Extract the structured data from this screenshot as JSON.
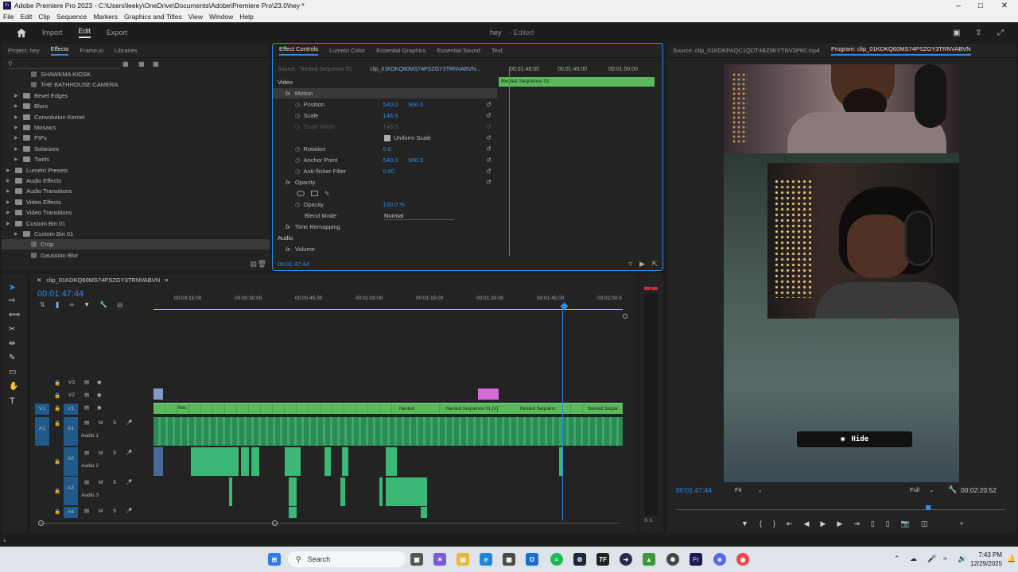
{
  "window": {
    "title": "Adobe Premiere Pro 2023 - C:\\Users\\leeky\\OneDrive\\Documents\\Adobe\\Premiere Pro\\23.0\\hey *",
    "logo": "Pr"
  },
  "menu": [
    "File",
    "Edit",
    "Clip",
    "Sequence",
    "Markers",
    "Graphics and Titles",
    "View",
    "Window",
    "Help"
  ],
  "workspaces": {
    "home_icon": "home-icon",
    "import": "Import",
    "edit": "Edit",
    "export": "Export",
    "project_name": "hey",
    "project_state": "- Edited"
  },
  "project_panel": {
    "tabs": [
      "Project: hey",
      "Effects",
      "Frame.io",
      "Libraries"
    ],
    "items": [
      {
        "label": "SHAWKMA KIOSK",
        "indent": 2,
        "folder": false
      },
      {
        "label": "THE BATHHOUSE CAMERA",
        "indent": 2,
        "folder": false
      },
      {
        "label": "Bevel Edges",
        "indent": 1,
        "folder": true
      },
      {
        "label": "Blurs",
        "indent": 1,
        "folder": true
      },
      {
        "label": "Convolution Kernel",
        "indent": 1,
        "folder": true
      },
      {
        "label": "Mosaics",
        "indent": 1,
        "folder": true
      },
      {
        "label": "PIPs",
        "indent": 1,
        "folder": true
      },
      {
        "label": "Solarizes",
        "indent": 1,
        "folder": true
      },
      {
        "label": "Twirls",
        "indent": 1,
        "folder": true
      },
      {
        "label": "Lumetri Presets",
        "indent": 0,
        "folder": true
      },
      {
        "label": "Audio Effects",
        "indent": 0,
        "folder": true
      },
      {
        "label": "Audio Transitions",
        "indent": 0,
        "folder": true
      },
      {
        "label": "Video Effects",
        "indent": 0,
        "folder": true
      },
      {
        "label": "Video Transitions",
        "indent": 0,
        "folder": true
      },
      {
        "label": "Custom Bin 01",
        "indent": 0,
        "folder": true
      },
      {
        "label": "Custom Bin 01",
        "indent": 1,
        "folder": true
      },
      {
        "label": "Crop",
        "indent": 2,
        "folder": false,
        "selected": true
      },
      {
        "label": "Gaussian Blur",
        "indent": 2,
        "folder": false
      }
    ]
  },
  "effect_controls": {
    "tabs": [
      "Effect Controls",
      "Lumetri Color",
      "Essential Graphics",
      "Essential Sound",
      "Text"
    ],
    "source": "Source - Nested Sequence 01",
    "clip": "clip_01KDKQ60MS74PSZGY3TRNVABVN...",
    "section_video": "Video",
    "motion": "Motion",
    "position_label": "Position",
    "position_x": "540.0",
    "position_y": "960.0",
    "scale_label": "Scale",
    "scale_value": "148.5",
    "scale_width_label": "Scale Width",
    "scale_width_value": "148.5",
    "uniform_scale": "Uniform Scale",
    "rotation_label": "Rotation",
    "rotation_value": "0.0",
    "anchor_label": "Anchor Point",
    "anchor_x": "540.0",
    "anchor_y": "960.0",
    "antiflicker_label": "Anti-flicker Filter",
    "antiflicker_value": "0.00",
    "opacity_section": "Opacity",
    "opacity_label": "Opacity",
    "opacity_value": "100.0 %",
    "blend_label": "Blend Mode",
    "blend_value": "Normal",
    "time_remap": "Time Remapping",
    "section_audio": "Audio",
    "volume": "Volume",
    "timecode": "00:01:47:44",
    "ruler": [
      "00:01:48:00",
      "00:01:49:00",
      "00:01:50:00"
    ],
    "nested_clip": "Nested Sequence 01"
  },
  "source_monitor": {
    "label": "Source: clip_01KDKPAQC1QDT4BZ9EYTNV2P80.mp4"
  },
  "program_monitor": {
    "label": "Program: clip_01KDKQ60MS74PSZGY3TRNVABVN",
    "timecode": "00:01:47:44",
    "fit": "Fit",
    "quality": "Full",
    "duration": "00:02:20:52",
    "overlay_button": "Hide"
  },
  "timeline": {
    "sequence_name": "clip_01KDKQ60MS74PSZGY3TRNVABVN",
    "timecode": "00:01:47:44",
    "ruler": [
      "00:00:15:00",
      "00:00:30:00",
      "00:00:45:00",
      "00:01:00:00",
      "00:01:15:00",
      "00:01:30:00",
      "00:01:45:00",
      "00:02:00:0"
    ],
    "tracks": {
      "v3": "V3",
      "v2": "V2",
      "v1": "V1",
      "v1_src": "V1",
      "a1": "A1",
      "a1_src": "A1",
      "a1_name": "Audio 1",
      "a2": "A2",
      "a2_name": "Audio 2",
      "a3": "A3",
      "a3_name": "Audio 3",
      "a4": "A4"
    },
    "clips": {
      "c1": "Nes",
      "c2": "Nested",
      "c3": "Nested Sequence 01 [V]",
      "c4": "Nested Sequenc",
      "c5": "Nested Seque"
    },
    "mute": "M",
    "solo": "S",
    "meter_solo": "S S"
  },
  "taskbar": {
    "search": "Search",
    "time": "7:43 PM",
    "date": "12/29/2025"
  }
}
